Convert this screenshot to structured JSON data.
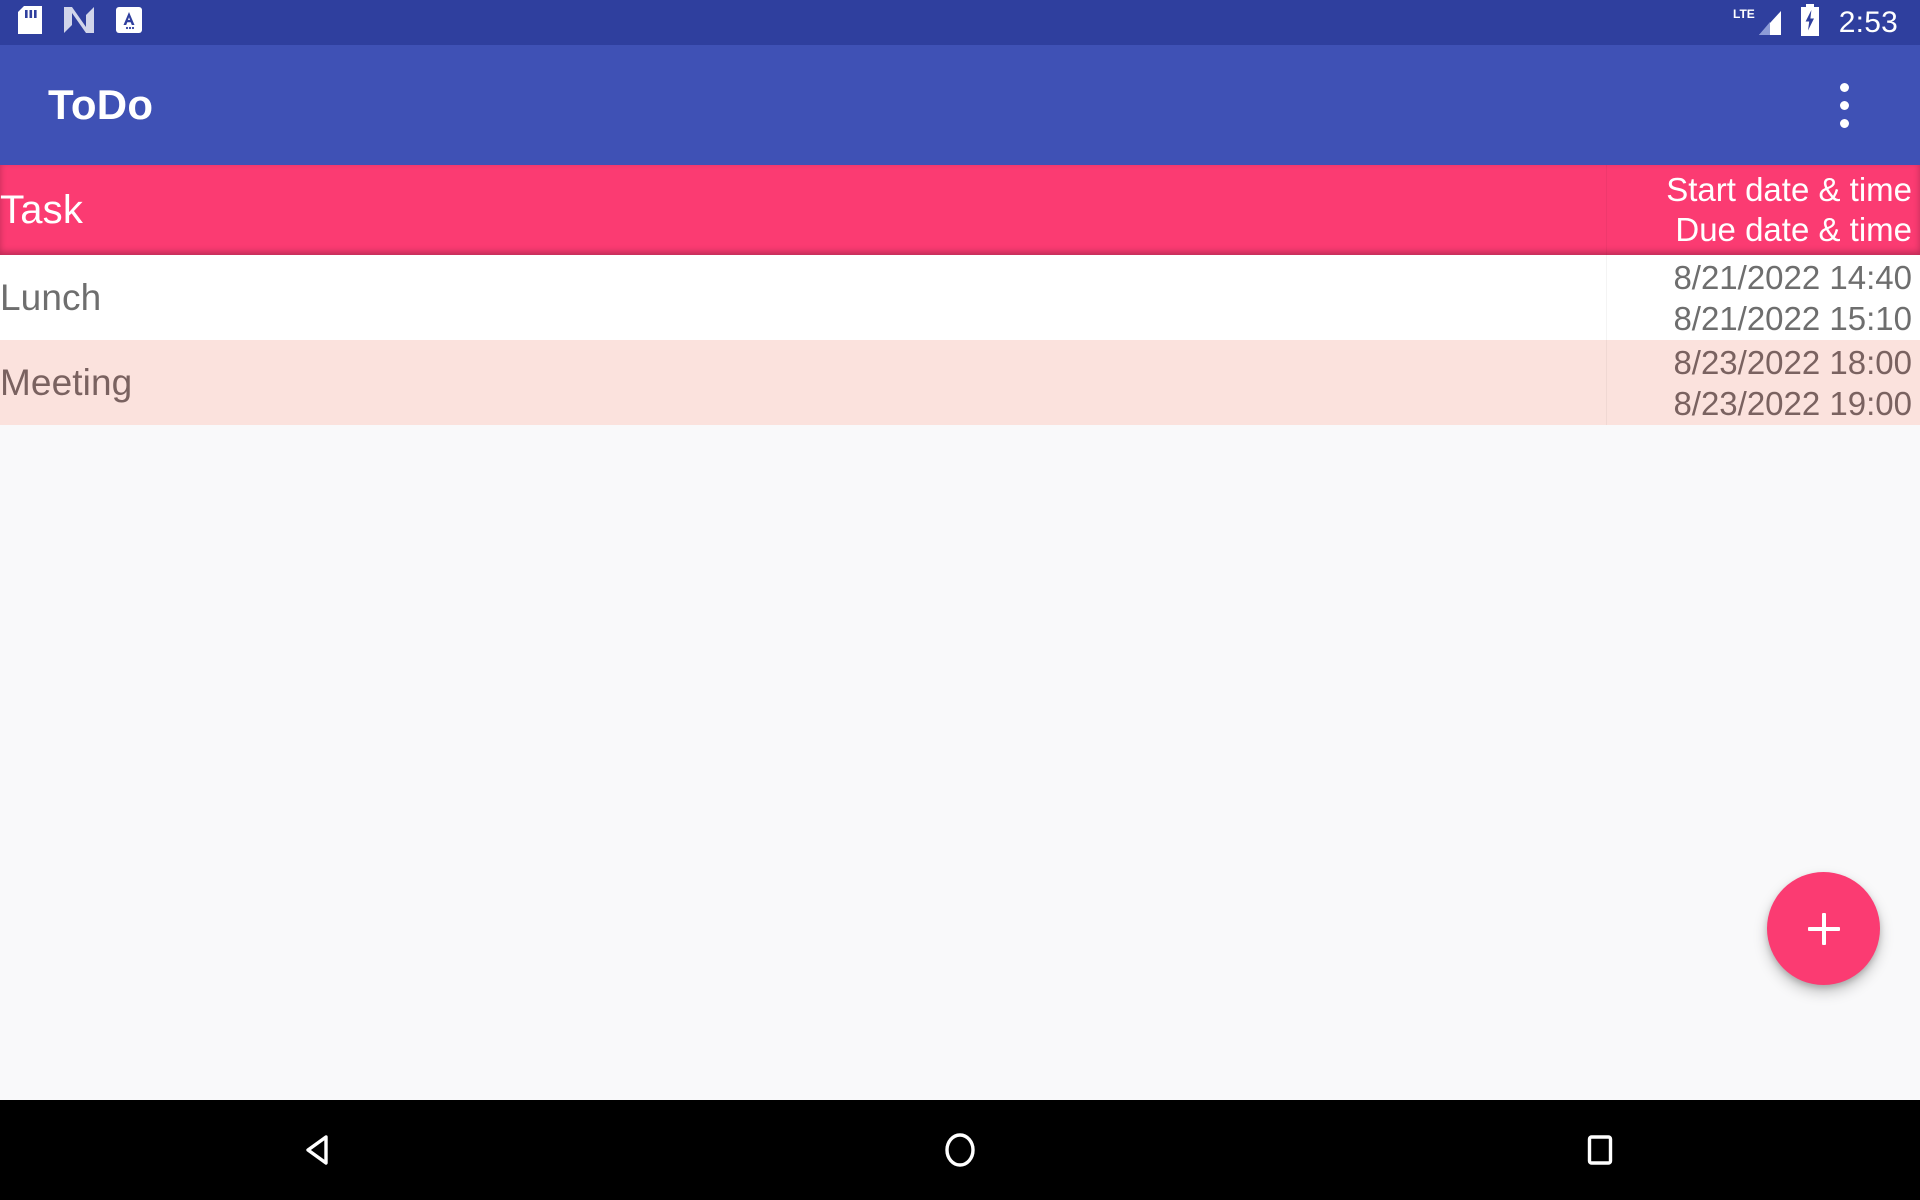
{
  "status_bar": {
    "icons": [
      "sd-card-icon",
      "android-n-icon",
      "keyboard-language-icon"
    ],
    "network": "LTE",
    "battery": "charging",
    "time": "2:53",
    "background_color": "#2f3f9e"
  },
  "app_bar": {
    "title": "ToDo",
    "overflow_menu_label": "More options",
    "background_color": "#3f51b5"
  },
  "table": {
    "header": {
      "task_label": "Task",
      "start_label": "Start date & time",
      "due_label": "Due date & time",
      "background_color": "#fb3b72"
    },
    "rows": [
      {
        "task": "Lunch",
        "start": "8/21/2022 14:40",
        "due": "8/21/2022 15:10",
        "background_color": "#ffffff"
      },
      {
        "task": "Meeting",
        "start": "8/23/2022 18:00",
        "due": "8/23/2022 19:00",
        "background_color": "#fbe2dd"
      }
    ]
  },
  "fab": {
    "label": "+",
    "name": "add-task-button",
    "color": "#fb3b72"
  },
  "nav_bar": {
    "back_label": "Back",
    "home_label": "Home",
    "recents_label": "Recent apps",
    "background_color": "#000000"
  }
}
